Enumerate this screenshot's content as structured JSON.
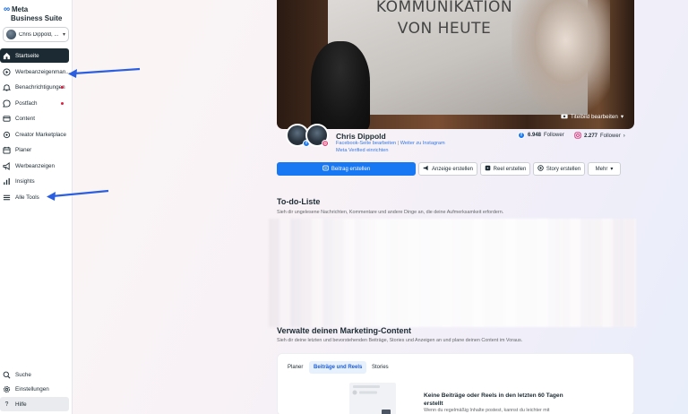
{
  "sidebar": {
    "logo_line1": "Meta",
    "logo_line2": "Business Suite",
    "account_name": "Chris Dippold, ...",
    "items": [
      {
        "label": "Startseite",
        "icon": "home-icon"
      },
      {
        "label": "Werbeanzeigenman...",
        "icon": "ads-manager-icon"
      },
      {
        "label": "Benachrichtigungen",
        "icon": "bell-icon"
      },
      {
        "label": "Postfach",
        "icon": "chat-bubble-icon"
      },
      {
        "label": "Content",
        "icon": "content-icon"
      },
      {
        "label": "Creator Marketplace",
        "icon": "creator-icon"
      },
      {
        "label": "Planer",
        "icon": "calendar-icon"
      },
      {
        "label": "Werbeanzeigen",
        "icon": "megaphone-icon"
      },
      {
        "label": "Insights",
        "icon": "bar-chart-icon"
      },
      {
        "label": "Alle Tools",
        "icon": "menu-icon"
      }
    ],
    "bottom_items": [
      {
        "label": "Suche",
        "icon": "search-icon"
      },
      {
        "label": "Einstellungen",
        "icon": "gear-icon"
      },
      {
        "label": "Hilfe",
        "icon": "help-icon"
      }
    ]
  },
  "cover": {
    "screen_line1": "KOMMUNIKATION",
    "screen_line2": "VON HEUTE",
    "edit_label": "Titelbild bearbeiten"
  },
  "profile": {
    "name": "Chris Dippold",
    "link_fb": "Facebook-Seite bearbeiten",
    "link_sep": "|",
    "link_ig": "Weiter zu Instagram",
    "verified": "Meta Verified einrichten",
    "fb_followers": "6.948",
    "fb_followers_label": "Follower",
    "ig_followers": "2.277",
    "ig_followers_label": "Follower"
  },
  "actions": {
    "create_post": "Beitrag erstellen",
    "create_ad": "Anzeige erstellen",
    "create_reel": "Reel erstellen",
    "create_story": "Story erstellen",
    "more": "Mehr"
  },
  "todo": {
    "title": "To-do-Liste",
    "subtitle": "Sieh dir ungelesene Nachrichten, Kommentare und andere Dinge an, die deine Aufmerksamkeit erfordern."
  },
  "marketing": {
    "title": "Verwalte deinen Marketing-Content",
    "subtitle": "Sieh dir deine letzten und bevorstehenden Beiträge, Stories und Anzeigen an und plane deinen Content im Voraus.",
    "tabs": [
      "Planer",
      "Beiträge und Reels",
      "Stories"
    ],
    "empty_title": "Keine Beiträge oder Reels in den letzten 60 Tagen erstellt",
    "empty_sub": "Wenn du regelmäßig Inhalte postest, kannst du leichter mit"
  },
  "colors": {
    "accent": "#1877f2",
    "active_nav": "#1c2b33",
    "arrow": "#2b5fe0"
  }
}
